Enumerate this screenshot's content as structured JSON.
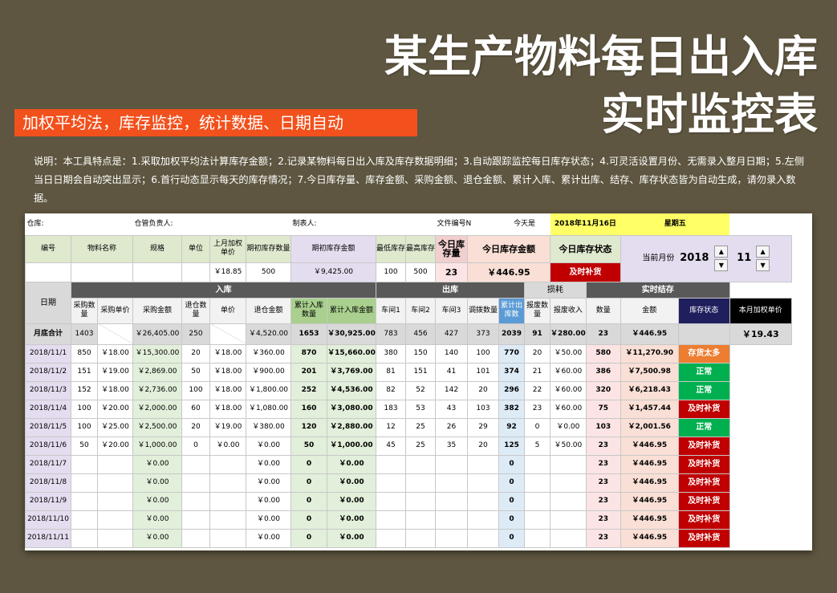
{
  "title_line1": "某生产物料每日出入库",
  "title_line2": "实时监控表",
  "subtitle": "加权平均法，库存监控，统计数据、日期自动",
  "description": "说明：本工具特点是：1.采取加权平均法计算库存金额；2.记录某物料每日出入库及库存数据明细；3.自动跟踪监控每日库存状态；4.可灵活设置月份、无需录入整月日期；5.左侧当日日期会自动突出显示；6.首行动态显示每天的库存情况；7.今日库存量、库存金额、采购金额、退仓金额、累计入库、累计出库、结存、库存状态皆为自动生成，请勿录入数据。",
  "sheet": {
    "info": {
      "warehouse": "仓库:",
      "manager": "仓管负责人:",
      "maker": "制表人:",
      "file_no": "文件编号N",
      "today_label": "今天是",
      "today_date": "2018年11月16日",
      "weekday": "星期五"
    },
    "hdr": {
      "code": "编号",
      "name": "物料名称",
      "spec": "规格",
      "unit": "单位",
      "last_price": "上月加权单价",
      "init_qty": "期初库存数量",
      "init_amt": "期初库存金额",
      "min_stock": "最低库存",
      "max_stock": "最高库存",
      "today_qty": "今日库存量",
      "today_amt": "今日库存金额",
      "today_status": "今日库存状态",
      "month_label": "当前月份",
      "year": "2018",
      "month": "11"
    },
    "vals": {
      "last_price": "￥18.85",
      "init_qty": "500",
      "init_amt": "￥9,425.00",
      "min_stock": "100",
      "max_stock": "500",
      "today_qty": "23",
      "today_amt": "￥446.95",
      "today_status": "及时补货"
    },
    "groups": {
      "date": "日期",
      "in": "入库",
      "out": "出库",
      "loss": "损耗",
      "balance": "实时结存"
    },
    "cols": {
      "buy_qty": "采购数量",
      "buy_price": "采购单价",
      "buy_amt": "采购金额",
      "ret_qty": "退仓数量",
      "ret_price": "单价",
      "ret_amt": "退仓金额",
      "cum_in_qty": "累计入库数量",
      "cum_in_amt": "累计入库金额",
      "ws1": "车间1",
      "ws2": "车间2",
      "ws3": "车间3",
      "transfer": "调拨数量",
      "cum_out": "累计出库数",
      "scrap_qty": "报废数量",
      "scrap_income": "报废收入",
      "qty": "数量",
      "amt": "金额",
      "status": "库存状态",
      "month_avg": "本月加权单价"
    },
    "total": {
      "label": "月底合计",
      "buy_qty": "1403",
      "buy_amt": "￥26,405.00",
      "ret_qty": "250",
      "ret_amt": "￥4,520.00",
      "cum_in_qty": "1653",
      "cum_in_amt": "￥30,925.00",
      "ws1": "783",
      "ws2": "456",
      "ws3": "427",
      "transfer": "373",
      "cum_out": "2039",
      "scrap_qty": "91",
      "scrap_income": "￥280.00",
      "qty": "23",
      "amt": "￥446.95",
      "month_avg": "￥19.43"
    },
    "rows": [
      {
        "date": "2018/11/1",
        "buy_qty": "850",
        "buy_price": "￥18.00",
        "buy_amt": "￥15,300.00",
        "ret_qty": "20",
        "ret_price": "￥18.00",
        "ret_amt": "￥360.00",
        "cum_in_qty": "870",
        "cum_in_amt": "￥15,660.00",
        "ws1": "380",
        "ws2": "150",
        "ws3": "140",
        "transfer": "100",
        "cum_out": "770",
        "scrap_qty": "20",
        "scrap_income": "￥50.00",
        "qty": "580",
        "amt": "￥11,270.90",
        "status": "存货太多",
        "st": "orange"
      },
      {
        "date": "2018/11/2",
        "buy_qty": "151",
        "buy_price": "￥19.00",
        "buy_amt": "￥2,869.00",
        "ret_qty": "50",
        "ret_price": "￥18.00",
        "ret_amt": "￥900.00",
        "cum_in_qty": "201",
        "cum_in_amt": "￥3,769.00",
        "ws1": "81",
        "ws2": "151",
        "ws3": "41",
        "transfer": "101",
        "cum_out": "374",
        "scrap_qty": "21",
        "scrap_income": "￥60.00",
        "qty": "386",
        "amt": "￥7,500.98",
        "status": "正常",
        "st": "green"
      },
      {
        "date": "2018/11/3",
        "buy_qty": "152",
        "buy_price": "￥18.00",
        "buy_amt": "￥2,736.00",
        "ret_qty": "100",
        "ret_price": "￥18.00",
        "ret_amt": "￥1,800.00",
        "cum_in_qty": "252",
        "cum_in_amt": "￥4,536.00",
        "ws1": "82",
        "ws2": "52",
        "ws3": "142",
        "transfer": "20",
        "cum_out": "296",
        "scrap_qty": "22",
        "scrap_income": "￥60.00",
        "qty": "320",
        "amt": "￥6,218.43",
        "status": "正常",
        "st": "green"
      },
      {
        "date": "2018/11/4",
        "buy_qty": "100",
        "buy_price": "￥20.00",
        "buy_amt": "￥2,000.00",
        "ret_qty": "60",
        "ret_price": "￥18.00",
        "ret_amt": "￥1,080.00",
        "cum_in_qty": "160",
        "cum_in_amt": "￥3,080.00",
        "ws1": "183",
        "ws2": "53",
        "ws3": "43",
        "transfer": "103",
        "cum_out": "382",
        "scrap_qty": "23",
        "scrap_income": "￥60.00",
        "qty": "75",
        "amt": "￥1,457.44",
        "status": "及时补货",
        "st": "red"
      },
      {
        "date": "2018/11/5",
        "buy_qty": "100",
        "buy_price": "￥25.00",
        "buy_amt": "￥2,500.00",
        "ret_qty": "20",
        "ret_price": "￥19.00",
        "ret_amt": "￥380.00",
        "cum_in_qty": "120",
        "cum_in_amt": "￥2,880.00",
        "ws1": "12",
        "ws2": "25",
        "ws3": "26",
        "transfer": "29",
        "cum_out": "92",
        "scrap_qty": "0",
        "scrap_income": "￥0.00",
        "qty": "103",
        "amt": "￥2,001.56",
        "status": "正常",
        "st": "green"
      },
      {
        "date": "2018/11/6",
        "buy_qty": "50",
        "buy_price": "￥20.00",
        "buy_amt": "￥1,000.00",
        "ret_qty": "0",
        "ret_price": "￥0.00",
        "ret_amt": "￥0.00",
        "cum_in_qty": "50",
        "cum_in_amt": "￥1,000.00",
        "ws1": "45",
        "ws2": "25",
        "ws3": "35",
        "transfer": "20",
        "cum_out": "125",
        "scrap_qty": "5",
        "scrap_income": "￥50.00",
        "qty": "23",
        "amt": "￥446.95",
        "status": "及时补货",
        "st": "red"
      },
      {
        "date": "2018/11/7",
        "buy_qty": "",
        "buy_price": "",
        "buy_amt": "￥0.00",
        "ret_qty": "",
        "ret_price": "",
        "ret_amt": "￥0.00",
        "cum_in_qty": "0",
        "cum_in_amt": "￥0.00",
        "ws1": "",
        "ws2": "",
        "ws3": "",
        "transfer": "",
        "cum_out": "0",
        "scrap_qty": "",
        "scrap_income": "",
        "qty": "23",
        "amt": "￥446.95",
        "status": "及时补货",
        "st": "red"
      },
      {
        "date": "2018/11/8",
        "buy_qty": "",
        "buy_price": "",
        "buy_amt": "￥0.00",
        "ret_qty": "",
        "ret_price": "",
        "ret_amt": "￥0.00",
        "cum_in_qty": "0",
        "cum_in_amt": "￥0.00",
        "ws1": "",
        "ws2": "",
        "ws3": "",
        "transfer": "",
        "cum_out": "0",
        "scrap_qty": "",
        "scrap_income": "",
        "qty": "23",
        "amt": "￥446.95",
        "status": "及时补货",
        "st": "red"
      },
      {
        "date": "2018/11/9",
        "buy_qty": "",
        "buy_price": "",
        "buy_amt": "￥0.00",
        "ret_qty": "",
        "ret_price": "",
        "ret_amt": "￥0.00",
        "cum_in_qty": "0",
        "cum_in_amt": "￥0.00",
        "ws1": "",
        "ws2": "",
        "ws3": "",
        "transfer": "",
        "cum_out": "0",
        "scrap_qty": "",
        "scrap_income": "",
        "qty": "23",
        "amt": "￥446.95",
        "status": "及时补货",
        "st": "red"
      },
      {
        "date": "2018/11/10",
        "buy_qty": "",
        "buy_price": "",
        "buy_amt": "￥0.00",
        "ret_qty": "",
        "ret_price": "",
        "ret_amt": "￥0.00",
        "cum_in_qty": "0",
        "cum_in_amt": "￥0.00",
        "ws1": "",
        "ws2": "",
        "ws3": "",
        "transfer": "",
        "cum_out": "0",
        "scrap_qty": "",
        "scrap_income": "",
        "qty": "23",
        "amt": "￥446.95",
        "status": "及时补货",
        "st": "red"
      },
      {
        "date": "2018/11/11",
        "buy_qty": "",
        "buy_price": "",
        "buy_amt": "￥0.00",
        "ret_qty": "",
        "ret_price": "",
        "ret_amt": "￥0.00",
        "cum_in_qty": "0",
        "cum_in_amt": "￥0.00",
        "ws1": "",
        "ws2": "",
        "ws3": "",
        "transfer": "",
        "cum_out": "0",
        "scrap_qty": "",
        "scrap_income": "",
        "qty": "23",
        "amt": "￥446.95",
        "status": "及时补货",
        "st": "red"
      }
    ],
    "spin_up": "▲",
    "spin_down": "▼"
  }
}
